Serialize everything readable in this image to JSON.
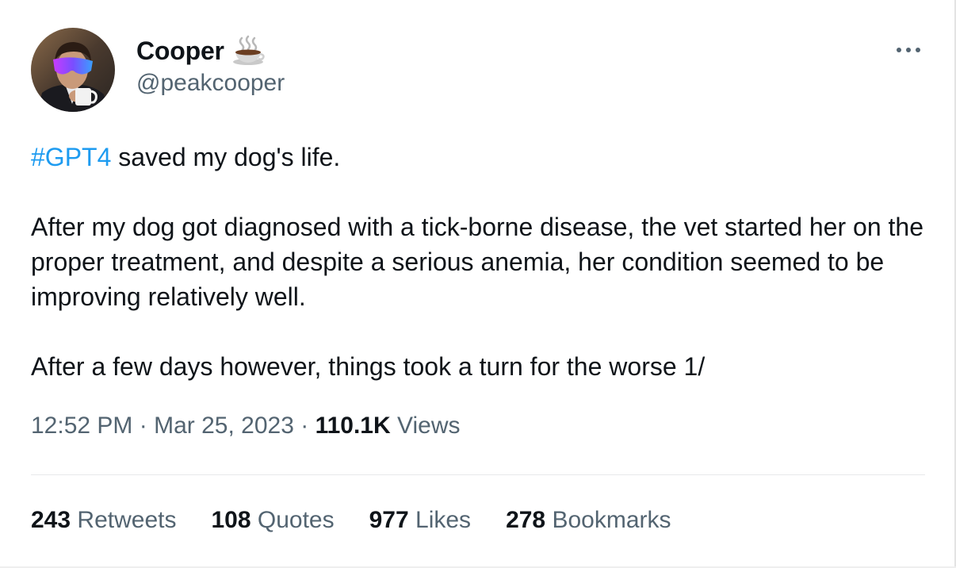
{
  "author": {
    "display_name": "Cooper",
    "name_emoji": "hot-beverage-emoji",
    "handle": "@peakcooper",
    "avatar": "avatar-photo"
  },
  "more_icon": "more-horizontal-icon",
  "tweet": {
    "hashtag": "#GPT4",
    "line1_rest": " saved my dog's life.",
    "para2": "After my dog got diagnosed with a tick-borne disease,  the vet started her on the proper treatment, and despite a serious anemia, her condition seemed to be improving relatively well.",
    "para3": "After a few days however, things took a turn for the worse 1/"
  },
  "meta": {
    "time": "12:52 PM",
    "separator": "·",
    "date": "Mar 25, 2023",
    "views_count": "110.1K",
    "views_label": "Views"
  },
  "stats": [
    {
      "count": "243",
      "label": "Retweets"
    },
    {
      "count": "108",
      "label": "Quotes"
    },
    {
      "count": "977",
      "label": "Likes"
    },
    {
      "count": "278",
      "label": "Bookmarks"
    }
  ],
  "colors": {
    "link": "#1d9bf0",
    "secondary_text": "#536471",
    "primary_text": "#0f1419",
    "divider": "#e7e9ea"
  }
}
